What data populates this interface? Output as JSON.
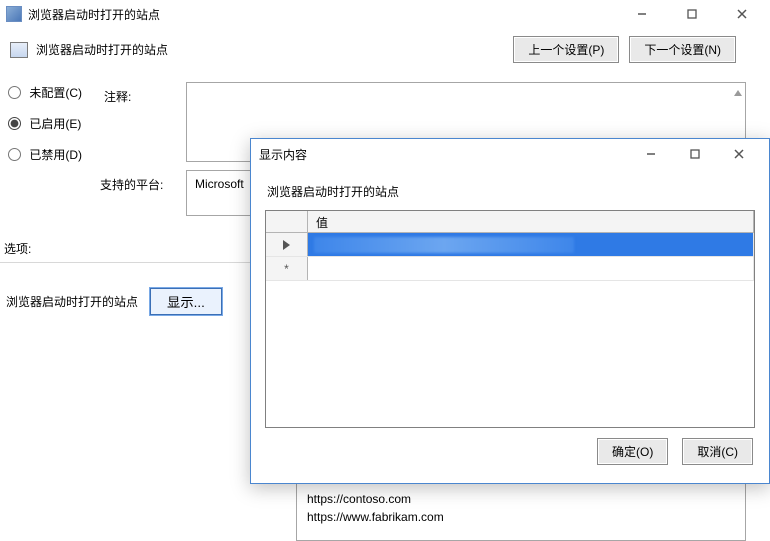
{
  "parent": {
    "title": "浏览器启动时打开的站点",
    "sub_title": "浏览器启动时打开的站点",
    "prev_btn": "上一个设置(P)",
    "next_btn": "下一个设置(N)",
    "radios": {
      "not_configured": "未配置(C)",
      "enabled": "已启用(E)",
      "disabled": "已禁用(D)"
    },
    "comment_label": "注释:",
    "platform_label": "支持的平台:",
    "platform_value": "Microsoft",
    "options_label": "选项:",
    "row_label": "浏览器启动时打开的站点",
    "show_btn": "显示...",
    "urls": [
      "https://contoso.com",
      "https://www.fabrikam.com"
    ]
  },
  "modal": {
    "title": "显示内容",
    "subtitle": "浏览器启动时打开的站点",
    "col_value": "值",
    "star": "*",
    "ok_btn": "确定(O)",
    "cancel_btn": "取消(C)"
  }
}
